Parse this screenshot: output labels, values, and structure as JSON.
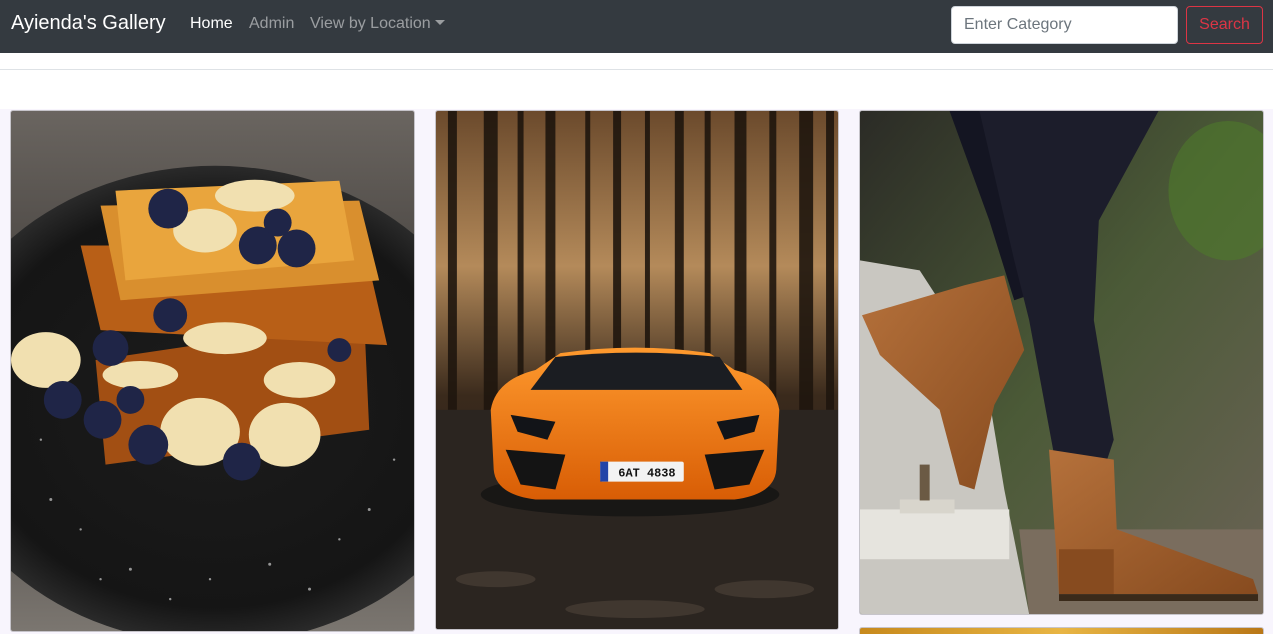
{
  "navbar": {
    "brand": "Ayienda's Gallery",
    "links": [
      {
        "label": "Home",
        "active": true
      },
      {
        "label": "Admin",
        "active": false
      },
      {
        "label": "View by Location",
        "dropdown": true
      }
    ],
    "search": {
      "placeholder": "Enter Category",
      "button_label": "Search"
    }
  },
  "colors": {
    "navbar_bg": "#343a40",
    "page_bg": "#f8f5fd",
    "search_accent": "#dc3545"
  },
  "gallery": {
    "images": [
      {
        "subject": "french-toast-with-blueberries-and-bananas"
      },
      {
        "subject": "orange-lamborghini-in-forest",
        "plate_text": "6AT 4838"
      },
      {
        "subject": "brown-leather-ankle-boots"
      },
      {
        "subject": "partially-visible-image"
      }
    ]
  }
}
